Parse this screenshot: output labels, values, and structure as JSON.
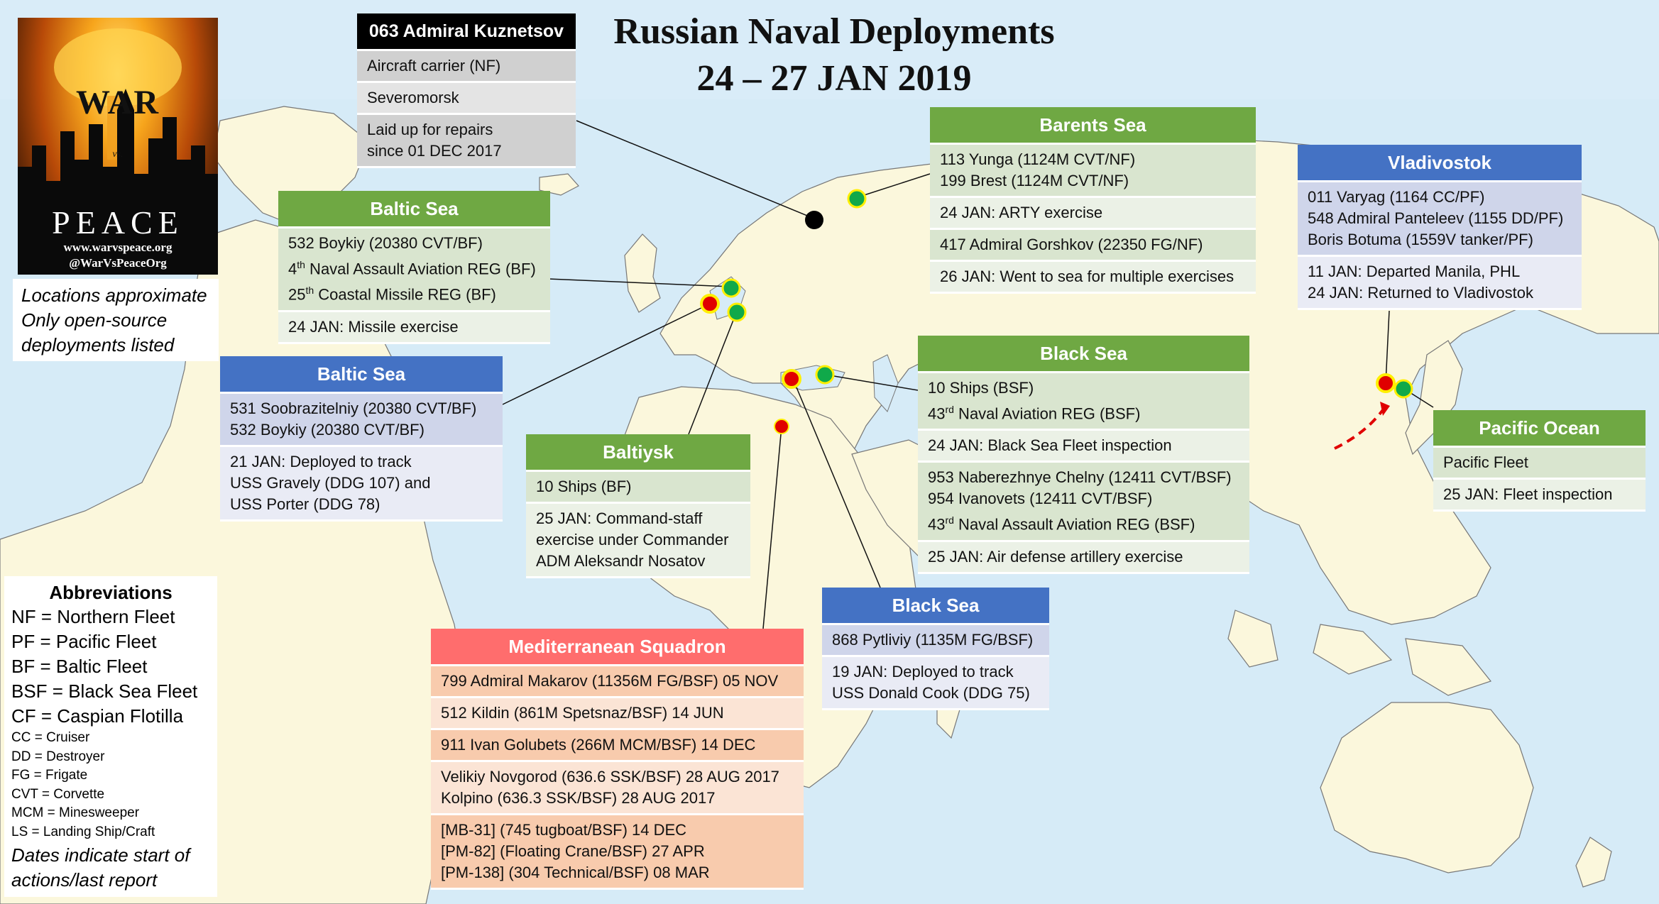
{
  "title": {
    "line1": "Russian Naval Deployments",
    "line2": "24 – 27 JAN 2019"
  },
  "logo": {
    "word_top": "WAR",
    "word_mid": "vs.",
    "word_bottom": "PEACE",
    "site": "www.warvspeace.org",
    "handle": "@WarVsPeaceOrg"
  },
  "notes": {
    "line1": "Locations approximate",
    "line2": "Only open-source",
    "line3": "deployments listed"
  },
  "kuznetsov": {
    "header": "063 Admiral Kuznetsov",
    "rows": [
      [
        "Aircraft carrier (NF)"
      ],
      [
        "Severomorsk"
      ],
      [
        "Laid up for repairs",
        "since 01 DEC 2017"
      ]
    ]
  },
  "barents": {
    "header": "Barents Sea",
    "rows": [
      [
        "113 Yunga (1124M CVT/NF)",
        "199 Brest (1124M CVT/NF)"
      ],
      [
        "24 JAN: ARTY exercise"
      ],
      [
        "417 Admiral Gorshkov (22350 FG/NF)"
      ],
      [
        "26 JAN: Went to sea for multiple exercises"
      ]
    ]
  },
  "vladivostok": {
    "header": "Vladivostok",
    "rows": [
      [
        "011 Varyag (1164 CC/PF)",
        "548 Admiral Panteleev (1155 DD/PF)",
        "Boris Botuma (1559V tanker/PF)"
      ],
      [
        "11 JAN: Departed Manila, PHL",
        "24 JAN: Returned to Vladivostok"
      ]
    ]
  },
  "baltic_green": {
    "header": "Baltic Sea",
    "rows": [
      [
        "532 Boykiy (20380 CVT/BF)",
        "4|th| Naval Assault Aviation REG (BF)",
        "25|th| Coastal Missile REG (BF)"
      ],
      [
        "24 JAN: Missile exercise"
      ]
    ]
  },
  "baltic_blue": {
    "header": "Baltic Sea",
    "rows": [
      [
        "531 Soobrazitelniy (20380 CVT/BF)",
        "532 Boykiy (20380 CVT/BF)"
      ],
      [
        "21 JAN: Deployed to track",
        "USS Gravely (DDG 107) and",
        "USS Porter (DDG 78)"
      ]
    ]
  },
  "baltiysk": {
    "header": "Baltiysk",
    "rows": [
      [
        "10 Ships (BF)"
      ],
      [
        "25 JAN: Command-staff",
        "exercise under Commander",
        "ADM Aleksandr Nosatov"
      ]
    ]
  },
  "black_green": {
    "header": "Black Sea",
    "rows": [
      [
        "10 Ships (BSF)",
        "43|rd| Naval Aviation REG (BSF)"
      ],
      [
        "24 JAN: Black Sea Fleet inspection"
      ],
      [
        "953 Naberezhnye Chelny (12411 CVT/BSF)",
        "954 Ivanovets (12411 CVT/BSF)",
        "43|rd| Naval Assault Aviation REG (BSF)"
      ],
      [
        "25 JAN: Air defense artillery exercise"
      ]
    ]
  },
  "black_blue": {
    "header": "Black Sea",
    "rows": [
      [
        "868 Pytliviy (1135M FG/BSF)"
      ],
      [
        "19 JAN: Deployed to track",
        "USS Donald Cook (DDG 75)"
      ]
    ]
  },
  "pacific": {
    "header": "Pacific Ocean",
    "rows": [
      [
        "Pacific Fleet"
      ],
      [
        "25 JAN: Fleet inspection"
      ]
    ]
  },
  "med": {
    "header": "Mediterranean Squadron",
    "rows": [
      [
        "799 Admiral Makarov (11356M FG/BSF) 05 NOV"
      ],
      [
        "512 Kildin (861M Spetsnaz/BSF) 14 JUN"
      ],
      [
        "911 Ivan Golubets (266M MCM/BSF) 14 DEC"
      ],
      [
        "Velikiy Novgorod (636.6 SSK/BSF) 28 AUG 2017",
        "Kolpino (636.3 SSK/BSF) 28 AUG 2017"
      ],
      [
        "[MB-31] (745 tugboat/BSF) 14 DEC",
        "[PM-82] (Floating Crane/BSF) 27 APR",
        "[PM-138] (304 Technical/BSF) 08 MAR"
      ]
    ]
  },
  "abbreviations": {
    "header": "Abbreviations",
    "major": [
      "NF = Northern Fleet",
      "PF = Pacific Fleet",
      "BF = Baltic Fleet",
      "BSF = Black Sea Fleet",
      "CF = Caspian Flotilla"
    ],
    "minor": [
      "CC = Cruiser",
      "DD = Destroyer",
      "FG = Frigate",
      "CVT = Corvette",
      "MCM = Minesweeper",
      "LS = Landing Ship/Craft"
    ],
    "footer_line1": "Dates indicate start of",
    "footer_line2": "actions/last report"
  },
  "colors": {
    "ocean": "#d6ebf7",
    "land": "#fbf7dc",
    "green_header": "#6fa843",
    "blue_header": "#4472c4",
    "red_header": "#ff6d6d",
    "marker_green": "#10a94a",
    "marker_red": "#e00000",
    "marker_ring": "#ffef00"
  }
}
